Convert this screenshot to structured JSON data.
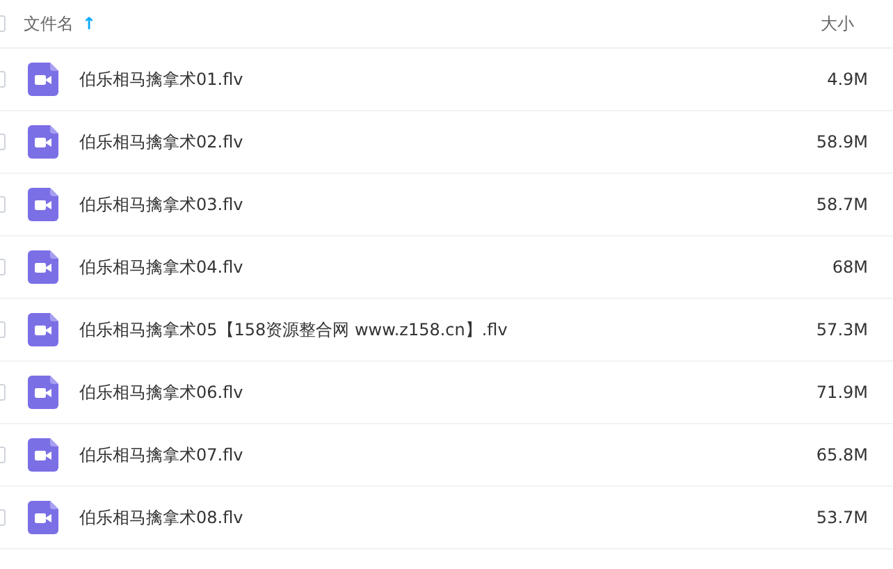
{
  "header": {
    "checked": false,
    "name_column": "文件名",
    "sort_arrow": "↑",
    "size_column": "大小"
  },
  "files": [
    {
      "name": "伯乐相马擒拿术01.flv",
      "size": "4.9M",
      "checked": false
    },
    {
      "name": "伯乐相马擒拿术02.flv",
      "size": "58.9M",
      "checked": false
    },
    {
      "name": "伯乐相马擒拿术03.flv",
      "size": "58.7M",
      "checked": false
    },
    {
      "name": "伯乐相马擒拿术04.flv",
      "size": "68M",
      "checked": false
    },
    {
      "name": "伯乐相马擒拿术05【158资源整合网 www.z158.cn】.flv",
      "size": "57.3M",
      "checked": false
    },
    {
      "name": "伯乐相马擒拿术06.flv",
      "size": "71.9M",
      "checked": false
    },
    {
      "name": "伯乐相马擒拿术07.flv",
      "size": "65.8M",
      "checked": false
    },
    {
      "name": "伯乐相马擒拿术08.flv",
      "size": "53.7M",
      "checked": false
    }
  ]
}
